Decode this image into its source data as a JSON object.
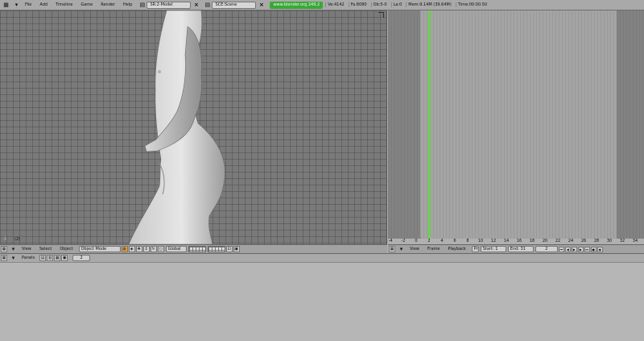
{
  "topbar": {
    "menus": [
      "File",
      "Add",
      "Timeline",
      "Game",
      "Render",
      "Help"
    ],
    "screen": "SR:2-Model",
    "scene": "SCE:Scene",
    "url": "www.blender.org 249.2",
    "stats": [
      "Ve:4142",
      "Fa:8080",
      "Ob:5-0",
      "La:0",
      "Mem:9.14M (39.64M)",
      "Time:00:00.50"
    ]
  },
  "viewport": {
    "frame": "(2)",
    "header": {
      "menus": [
        "View",
        "Select",
        "Object"
      ],
      "mode": "Object Mode",
      "orientation": "Global"
    }
  },
  "timeline": {
    "current_frame": 2,
    "ruler": [
      "-4",
      "-2",
      "0",
      "2",
      "4",
      "6",
      "8",
      "10",
      "12",
      "14",
      "16",
      "18",
      "20",
      "22",
      "24",
      "26",
      "28",
      "30",
      "32",
      "34"
    ],
    "header": {
      "menus": [
        "View",
        "Frame",
        "Playback"
      ],
      "pr": "Pr",
      "start": "Start: 1",
      "end": "End: 31",
      "frame": "2"
    }
  },
  "buttons": {
    "label": "Panels",
    "frame": "2"
  }
}
